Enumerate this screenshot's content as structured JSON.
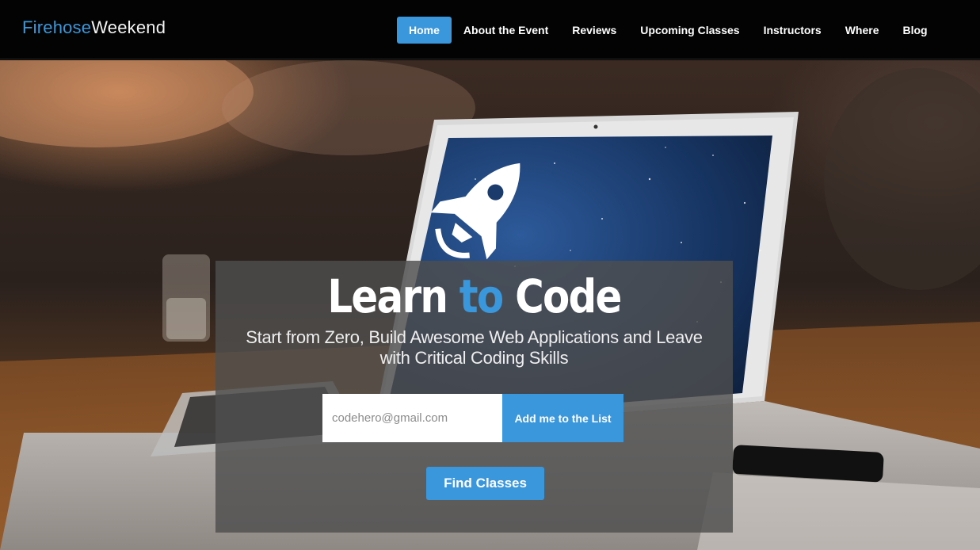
{
  "brand": {
    "part1": "Firehose",
    "part2": "Weekend"
  },
  "nav": {
    "items": [
      {
        "label": "Home",
        "active": true
      },
      {
        "label": "About the Event"
      },
      {
        "label": "Reviews"
      },
      {
        "label": "Upcoming Classes"
      },
      {
        "label": "Instructors"
      },
      {
        "label": "Where"
      },
      {
        "label": "Blog"
      }
    ]
  },
  "hero": {
    "headline_pre": "Learn ",
    "headline_accent": "to",
    "headline_post": " Code",
    "subhead": "Start from Zero, Build Awesome Web Applications and Leave with Critical Coding Skills",
    "email_placeholder": "codehero@gmail.com",
    "email_value": "",
    "signup_label": "Add me to the List",
    "find_label": "Find Classes",
    "rocket_icon": "rocket-icon"
  },
  "colors": {
    "accent": "#3a97dc",
    "navbar_bg": "#030303",
    "cta_overlay": "rgba(78,78,78,0.82)"
  }
}
